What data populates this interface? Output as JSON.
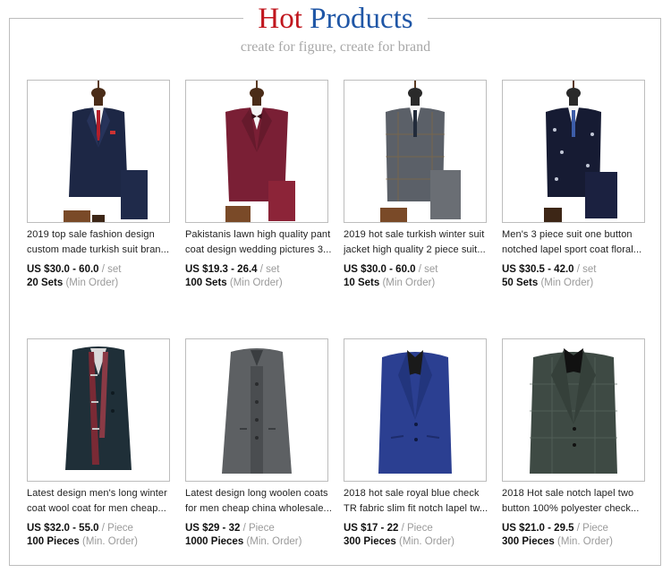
{
  "header": {
    "title_hot": "Hot",
    "title_products": "Products",
    "subtitle": "create for figure, create for brand"
  },
  "products": [
    {
      "title_line1": "2019 top sale fashion design",
      "title_line2": "custom made turkish suit bran...",
      "price": "US $30.0 - 60.0",
      "unit": " / set",
      "qty": "20 Sets",
      "qty_label": " (Min Order)",
      "image": "navy-three-piece-suit-red-tie"
    },
    {
      "title_line1": "Pakistanis lawn high quality pant",
      "title_line2": "coat design wedding pictures 3...",
      "price": "US $19.3 - 26.4",
      "unit": " / set",
      "qty": "100 Sets",
      "qty_label": " (Min Order)",
      "image": "burgundy-suit-bow-tie"
    },
    {
      "title_line1": "2019 hot sale turkish winter suit",
      "title_line2": "jacket high quality 2 piece suit...",
      "price": "US $30.0 - 60.0",
      "unit": " / set",
      "qty": "10 Sets",
      "qty_label": " (Min Order)",
      "image": "grey-plaid-suit"
    },
    {
      "title_line1": "Men's 3 piece suit one button",
      "title_line2": "notched lapel sport coat floral...",
      "price": "US $30.5 - 42.0",
      "unit": " / set",
      "qty": "50 Sets",
      "qty_label": " (Min Order)",
      "image": "navy-floral-suit"
    },
    {
      "title_line1": "Latest design men's long winter",
      "title_line2": "coat wool coat for men cheap...",
      "price": "US $32.0 - 55.0",
      "unit": " / Piece",
      "qty": "100 Pieces",
      "qty_label": " (Min. Order)",
      "image": "dark-teal-overcoat-scarf"
    },
    {
      "title_line1": "Latest design long woolen coats",
      "title_line2": "for men cheap china wholesale...",
      "price": "US $29 - 32",
      "unit": " / Piece",
      "qty": "1000 Pieces",
      "qty_label": " (Min. Order)",
      "image": "grey-long-coat"
    },
    {
      "title_line1": "2018 hot sale royal blue check",
      "title_line2": "TR fabric slim fit notch lapel tw...",
      "price": "US $17 - 22",
      "unit": " / Piece",
      "qty": "300 Pieces",
      "qty_label": " (Min. Order)",
      "image": "royal-blue-check-blazer"
    },
    {
      "title_line1": "2018 Hot sale notch lapel two",
      "title_line2": "button 100% polyester check...",
      "price": "US $21.0 - 29.5",
      "unit": " / Piece",
      "qty": "300 Pieces",
      "qty_label": " (Min. Order)",
      "image": "green-check-blazer"
    }
  ],
  "colors": {
    "hot": "#c0161d",
    "products": "#1f56a6",
    "muted": "#9a9a9a",
    "border": "#bdbdbd"
  }
}
